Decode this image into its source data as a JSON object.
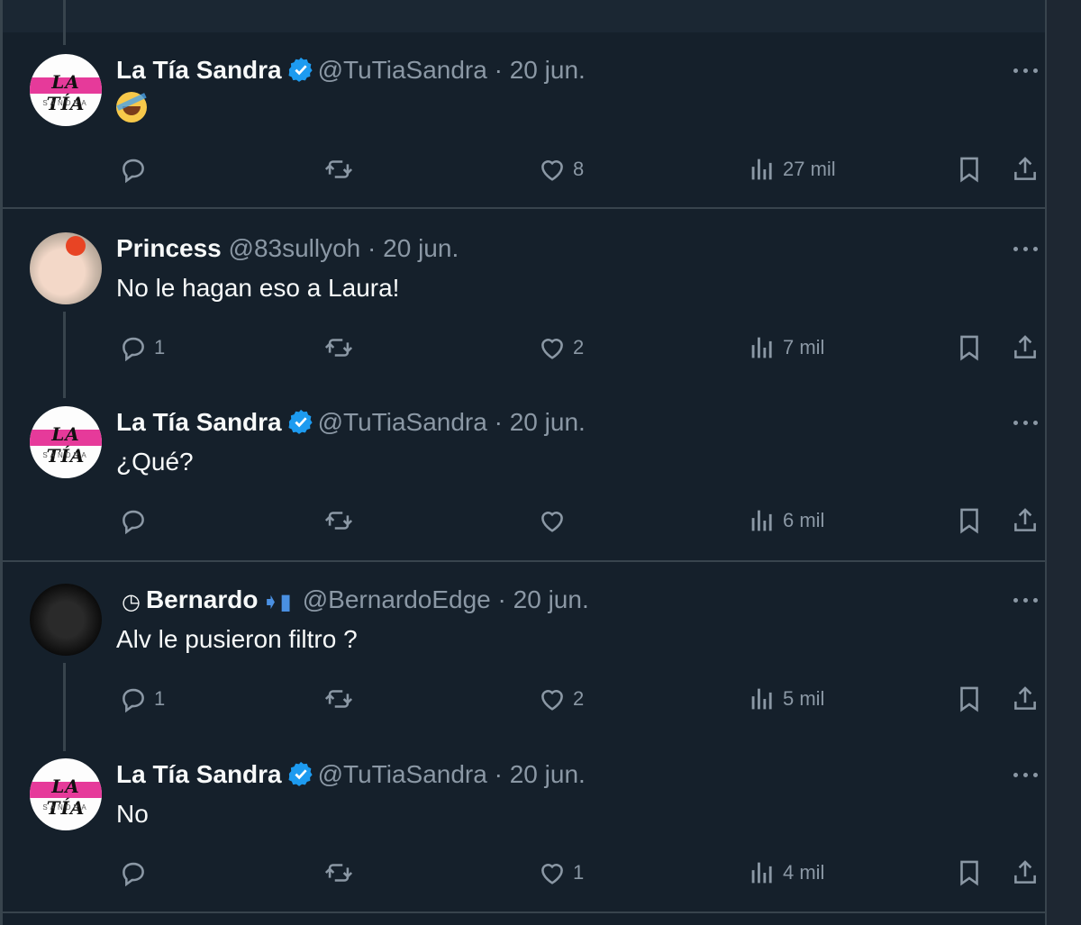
{
  "app": {
    "accent": "#1d9bf0",
    "background": "#15202b"
  },
  "tweets": [
    {
      "name": "La Tía Sandra",
      "verified": true,
      "handle": "@TuTiaSandra",
      "date": "· 20 jun.",
      "text": "",
      "text_icon": "rolling-on-floor-laughing-emoji",
      "avatar_text": "LA TÍA",
      "avatar_sub": "SANDRA",
      "replies": "",
      "retweets": "",
      "likes": "8",
      "views": "27 mil"
    },
    {
      "name": "Princess",
      "verified": false,
      "handle": "@83sullyoh",
      "date": "· 20 jun.",
      "text": "No le hagan eso a Laura!",
      "replies": "1",
      "retweets": "",
      "likes": "2",
      "views": "7 mil"
    },
    {
      "name": "La Tía Sandra",
      "verified": true,
      "handle": "@TuTiaSandra",
      "date": "· 20 jun.",
      "text": "¿Qué?",
      "avatar_text": "LA TÍA",
      "avatar_sub": "SANDRA",
      "replies": "",
      "retweets": "",
      "likes": "",
      "views": "6 mil"
    },
    {
      "name": "Bernardo",
      "name_prefix_icons": [
        "apple-logo-icon",
        "clock-icon"
      ],
      "name_suffix_icons": [
        "arrow-to-phone-icon",
        "apple-logo-icon"
      ],
      "verified": false,
      "handle": "@BernardoEdge",
      "date": "· 20 jun.",
      "text": "Alv le pusieron filtro ?",
      "replies": "1",
      "retweets": "",
      "likes": "2",
      "views": "5 mil"
    },
    {
      "name": "La Tía Sandra",
      "verified": true,
      "handle": "@TuTiaSandra",
      "date": "· 20 jun.",
      "text": "No",
      "avatar_text": "LA TÍA",
      "avatar_sub": "SANDRA",
      "replies": "",
      "retweets": "",
      "likes": "1",
      "views": "4 mil"
    }
  ]
}
